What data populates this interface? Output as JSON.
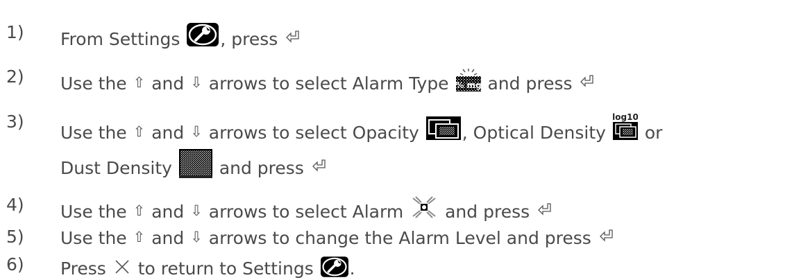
{
  "steps": [
    {
      "num": "1)",
      "parts": [
        "From Settings",
        ", press"
      ]
    },
    {
      "num": "2)",
      "parts": [
        "Use the",
        "and",
        "arrows to select Alarm Type",
        "and press"
      ]
    },
    {
      "num": "3)",
      "parts": [
        "Use the",
        "and",
        "arrows to select Opacity",
        ", Optical Density",
        "or"
      ],
      "cont": [
        "Dust Density",
        "and press"
      ]
    },
    {
      "num": "4)",
      "parts": [
        "Use the",
        "and",
        "arrows to select Alarm",
        "and press"
      ]
    },
    {
      "num": "5)",
      "parts": [
        "Use the",
        "and",
        "arrows to change the Alarm Level and press"
      ]
    },
    {
      "num": "6)",
      "parts": [
        "Press",
        "to return to Settings",
        "."
      ]
    }
  ],
  "icon_labels": {
    "alarm_type": "% mg",
    "optical_density": "log10"
  },
  "icons": {
    "settings": "settings-wrench-icon",
    "enter": "enter-key-icon",
    "up": "up-arrow-icon",
    "down": "down-arrow-icon",
    "close": "close-x-icon",
    "alarm_type": "alarm-type-icon",
    "opacity": "opacity-icon",
    "optical_density": "optical-density-icon",
    "dust_density": "dust-density-icon",
    "alarm": "alarm-icon"
  },
  "colors": {
    "text": "#4a4a4a",
    "icon_bg": "#000000",
    "icon_fg": "#ffffff"
  }
}
